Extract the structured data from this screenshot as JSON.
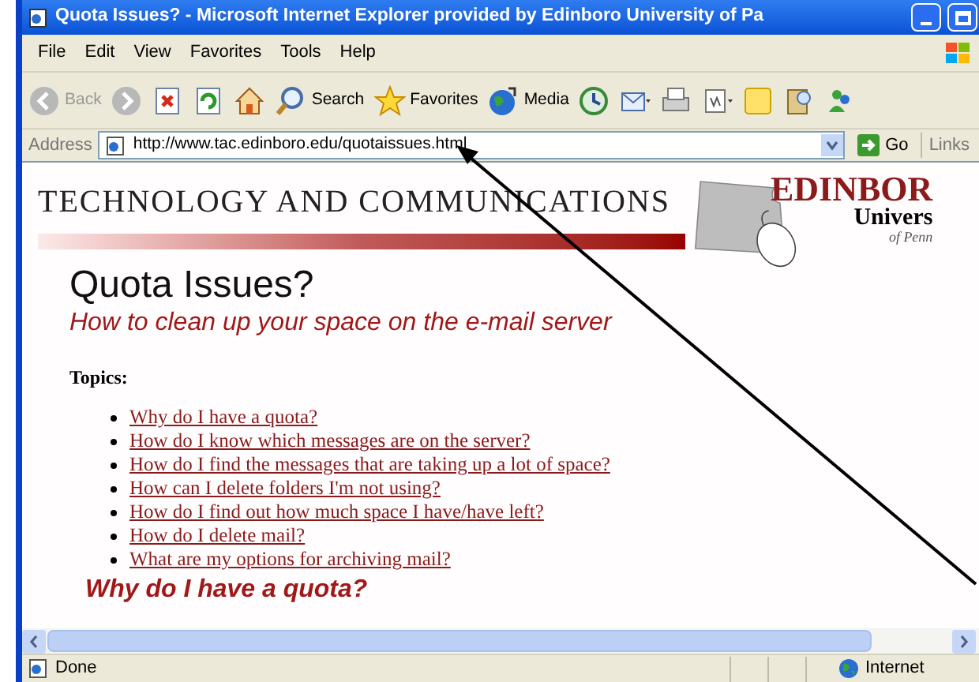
{
  "window": {
    "title": "Quota Issues? - Microsoft Internet Explorer provided by Edinboro University of Pa"
  },
  "menu": [
    "File",
    "Edit",
    "View",
    "Favorites",
    "Tools",
    "Help"
  ],
  "toolbar": [
    {
      "kind": "back",
      "label": "Back",
      "disabled": true
    },
    {
      "kind": "forward",
      "disabled": true
    },
    {
      "kind": "stop"
    },
    {
      "kind": "refresh"
    },
    {
      "kind": "home"
    },
    {
      "kind": "search",
      "label": "Search"
    },
    {
      "kind": "favorites",
      "label": "Favorites"
    },
    {
      "kind": "media",
      "label": "Media"
    },
    {
      "kind": "history"
    },
    {
      "kind": "mail"
    },
    {
      "kind": "print"
    },
    {
      "kind": "edit"
    },
    {
      "kind": "note"
    },
    {
      "kind": "research"
    },
    {
      "kind": "messenger"
    }
  ],
  "address": {
    "label": "Address",
    "value": "http://www.tac.edinboro.edu/quotaissues.html",
    "go": "Go",
    "links": "Links"
  },
  "page": {
    "banner": "TECHNOLOGY AND COMMUNICATIONS",
    "logo": {
      "name": "EDINBOR",
      "line2": "Univers",
      "line3": "of Penn"
    },
    "title": "Quota Issues?",
    "subtitle": "How to clean up your space on the e-mail server",
    "topics_label": "Topics:",
    "topics": [
      "Why do I have a quota?",
      "How do I know which messages are on the server?",
      "How do I find the messages that are taking up a lot of space?",
      "How can I delete folders I'm not using?",
      "How do I find out how much space I have/have left?",
      "How do I delete mail?",
      "What are my options for archiving mail?"
    ],
    "section_heading": "Why do I have a quota?"
  },
  "status_bar": {
    "text": "Done",
    "zone": "Internet"
  }
}
